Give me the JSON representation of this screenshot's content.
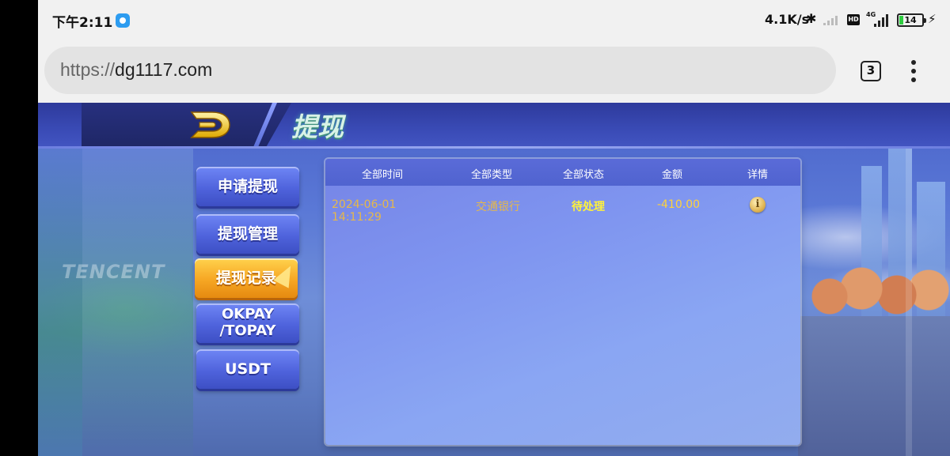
{
  "status_bar": {
    "time": "下午2:11",
    "net_speed": "4.1K/s",
    "hd_badge": "HD",
    "network_type": "4G",
    "battery_level": "14",
    "app_icon": "notification-app-icon",
    "bluetooth_icon": "bluetooth-icon",
    "charging_icon": "charging-icon"
  },
  "browser": {
    "url_scheme": "https://",
    "url_host": "dg1117.com",
    "tab_count": "3",
    "menu_icon": "more-vertical-icon"
  },
  "game": {
    "logo_icon": "d-logo-icon",
    "title": "提现",
    "sidebar": {
      "items": [
        {
          "label": "申请提现",
          "active": false
        },
        {
          "label": "提现管理",
          "active": false
        },
        {
          "label": "提现记录",
          "active": true
        },
        {
          "label": "OKPAY\n/TOPAY",
          "active": false
        },
        {
          "label": "USDT",
          "active": false
        }
      ]
    },
    "records": {
      "headers": {
        "time": "全部时间",
        "type": "全部类型",
        "status": "全部状态",
        "amount": "金额",
        "detail": "详情"
      },
      "rows": [
        {
          "time": "2024-06-01 14:11:29",
          "type": "交通银行",
          "status": "待处理",
          "amount": "-410.00",
          "detail_icon": "info-icon"
        }
      ]
    },
    "background_text": "TENCENT",
    "colors": {
      "accent_active": "#f6a623",
      "button_blue": "#4f63dc",
      "status_pending": "#fff23a",
      "amount": "#ffd23a"
    }
  }
}
